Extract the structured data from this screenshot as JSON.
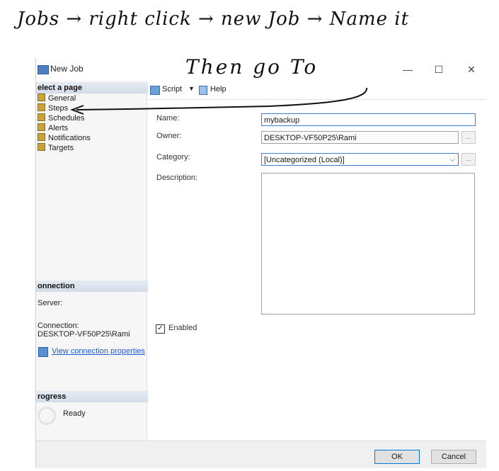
{
  "annotations": {
    "line1": "Jobs → right click → new Job → Name it",
    "line2": "Then go To"
  },
  "window": {
    "title": "New Job",
    "minimize": "—",
    "maximize": "☐",
    "close": "✕"
  },
  "left_pane": {
    "select_page_heading": "elect a page",
    "pages": [
      "General",
      "Steps",
      "Schedules",
      "Alerts",
      "Notifications",
      "Targets"
    ],
    "connection_heading": "onnection",
    "server_label": "Server:",
    "connection_label": "Connection:",
    "connection_value": "DESKTOP-VF50P25\\Rami",
    "view_connection_link": "View connection properties",
    "progress_heading": "rogress",
    "progress_status": "Ready"
  },
  "toolbar": {
    "script_label": "Script",
    "help_label": "Help"
  },
  "form": {
    "name_label": "Name:",
    "name_value": "mybackup",
    "owner_label": "Owner:",
    "owner_value": "DESKTOP-VF50P25\\Rami",
    "owner_browse": "...",
    "category_label": "Category:",
    "category_value": "[Uncategorized (Local)]",
    "category_browse": "...",
    "description_label": "Description:",
    "enabled_label": "Enabled",
    "enabled_checked": true
  },
  "buttons": {
    "ok": "OK",
    "cancel": "Cancel"
  },
  "colors": {
    "link": "#1d5bd6",
    "focus_border": "#3c7fd0",
    "section_header": "#d3dce8"
  }
}
